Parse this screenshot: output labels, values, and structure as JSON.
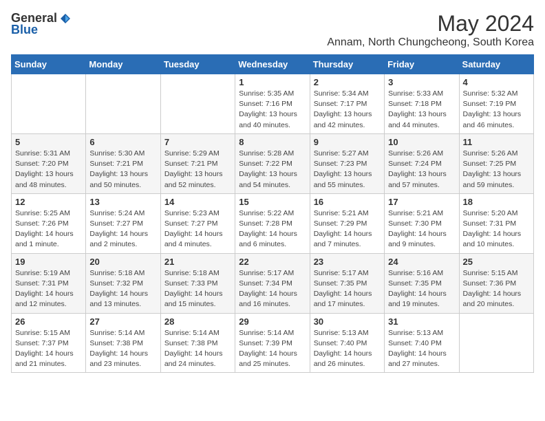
{
  "header": {
    "logo_general": "General",
    "logo_blue": "Blue",
    "main_title": "May 2024",
    "subtitle": "Annam, North Chungcheong, South Korea"
  },
  "weekdays": [
    "Sunday",
    "Monday",
    "Tuesday",
    "Wednesday",
    "Thursday",
    "Friday",
    "Saturday"
  ],
  "weeks": [
    [
      {
        "day": "",
        "info": ""
      },
      {
        "day": "",
        "info": ""
      },
      {
        "day": "",
        "info": ""
      },
      {
        "day": "1",
        "info": "Sunrise: 5:35 AM\nSunset: 7:16 PM\nDaylight: 13 hours\nand 40 minutes."
      },
      {
        "day": "2",
        "info": "Sunrise: 5:34 AM\nSunset: 7:17 PM\nDaylight: 13 hours\nand 42 minutes."
      },
      {
        "day": "3",
        "info": "Sunrise: 5:33 AM\nSunset: 7:18 PM\nDaylight: 13 hours\nand 44 minutes."
      },
      {
        "day": "4",
        "info": "Sunrise: 5:32 AM\nSunset: 7:19 PM\nDaylight: 13 hours\nand 46 minutes."
      }
    ],
    [
      {
        "day": "5",
        "info": "Sunrise: 5:31 AM\nSunset: 7:20 PM\nDaylight: 13 hours\nand 48 minutes."
      },
      {
        "day": "6",
        "info": "Sunrise: 5:30 AM\nSunset: 7:21 PM\nDaylight: 13 hours\nand 50 minutes."
      },
      {
        "day": "7",
        "info": "Sunrise: 5:29 AM\nSunset: 7:21 PM\nDaylight: 13 hours\nand 52 minutes."
      },
      {
        "day": "8",
        "info": "Sunrise: 5:28 AM\nSunset: 7:22 PM\nDaylight: 13 hours\nand 54 minutes."
      },
      {
        "day": "9",
        "info": "Sunrise: 5:27 AM\nSunset: 7:23 PM\nDaylight: 13 hours\nand 55 minutes."
      },
      {
        "day": "10",
        "info": "Sunrise: 5:26 AM\nSunset: 7:24 PM\nDaylight: 13 hours\nand 57 minutes."
      },
      {
        "day": "11",
        "info": "Sunrise: 5:26 AM\nSunset: 7:25 PM\nDaylight: 13 hours\nand 59 minutes."
      }
    ],
    [
      {
        "day": "12",
        "info": "Sunrise: 5:25 AM\nSunset: 7:26 PM\nDaylight: 14 hours\nand 1 minute."
      },
      {
        "day": "13",
        "info": "Sunrise: 5:24 AM\nSunset: 7:27 PM\nDaylight: 14 hours\nand 2 minutes."
      },
      {
        "day": "14",
        "info": "Sunrise: 5:23 AM\nSunset: 7:27 PM\nDaylight: 14 hours\nand 4 minutes."
      },
      {
        "day": "15",
        "info": "Sunrise: 5:22 AM\nSunset: 7:28 PM\nDaylight: 14 hours\nand 6 minutes."
      },
      {
        "day": "16",
        "info": "Sunrise: 5:21 AM\nSunset: 7:29 PM\nDaylight: 14 hours\nand 7 minutes."
      },
      {
        "day": "17",
        "info": "Sunrise: 5:21 AM\nSunset: 7:30 PM\nDaylight: 14 hours\nand 9 minutes."
      },
      {
        "day": "18",
        "info": "Sunrise: 5:20 AM\nSunset: 7:31 PM\nDaylight: 14 hours\nand 10 minutes."
      }
    ],
    [
      {
        "day": "19",
        "info": "Sunrise: 5:19 AM\nSunset: 7:31 PM\nDaylight: 14 hours\nand 12 minutes."
      },
      {
        "day": "20",
        "info": "Sunrise: 5:18 AM\nSunset: 7:32 PM\nDaylight: 14 hours\nand 13 minutes."
      },
      {
        "day": "21",
        "info": "Sunrise: 5:18 AM\nSunset: 7:33 PM\nDaylight: 14 hours\nand 15 minutes."
      },
      {
        "day": "22",
        "info": "Sunrise: 5:17 AM\nSunset: 7:34 PM\nDaylight: 14 hours\nand 16 minutes."
      },
      {
        "day": "23",
        "info": "Sunrise: 5:17 AM\nSunset: 7:35 PM\nDaylight: 14 hours\nand 17 minutes."
      },
      {
        "day": "24",
        "info": "Sunrise: 5:16 AM\nSunset: 7:35 PM\nDaylight: 14 hours\nand 19 minutes."
      },
      {
        "day": "25",
        "info": "Sunrise: 5:15 AM\nSunset: 7:36 PM\nDaylight: 14 hours\nand 20 minutes."
      }
    ],
    [
      {
        "day": "26",
        "info": "Sunrise: 5:15 AM\nSunset: 7:37 PM\nDaylight: 14 hours\nand 21 minutes."
      },
      {
        "day": "27",
        "info": "Sunrise: 5:14 AM\nSunset: 7:38 PM\nDaylight: 14 hours\nand 23 minutes."
      },
      {
        "day": "28",
        "info": "Sunrise: 5:14 AM\nSunset: 7:38 PM\nDaylight: 14 hours\nand 24 minutes."
      },
      {
        "day": "29",
        "info": "Sunrise: 5:14 AM\nSunset: 7:39 PM\nDaylight: 14 hours\nand 25 minutes."
      },
      {
        "day": "30",
        "info": "Sunrise: 5:13 AM\nSunset: 7:40 PM\nDaylight: 14 hours\nand 26 minutes."
      },
      {
        "day": "31",
        "info": "Sunrise: 5:13 AM\nSunset: 7:40 PM\nDaylight: 14 hours\nand 27 minutes."
      },
      {
        "day": "",
        "info": ""
      }
    ]
  ]
}
